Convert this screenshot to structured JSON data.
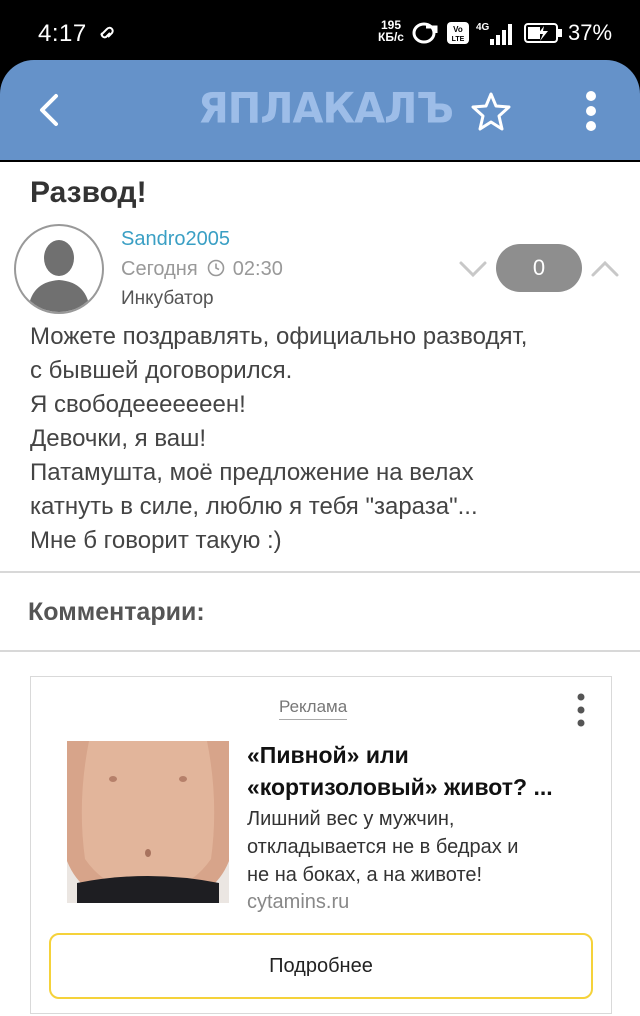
{
  "status_bar": {
    "time": "4:17",
    "speed_value": "195",
    "speed_unit": "КБ/с",
    "network_label": "4G",
    "volte_label": "Vo LTE",
    "battery_percent": "37%"
  },
  "app_bar": {
    "logo_text": "ЯПЛАКАЛЪ",
    "accent_color": "#6592c9"
  },
  "post": {
    "title": "Развод!",
    "author": "Sandro2005",
    "date": "Сегодня",
    "time": "02:30",
    "rank": "Инкубатор",
    "rating": "0",
    "body_lines": [
      "Можете поздравлять, официально разводят,",
      "с бывшей договорился.",
      "Я свободееееееен!",
      "Девочки, я ваш!",
      "Патамушта, моё предложение на велах",
      "катнуть в силе, люблю я тебя \"зараза\"...",
      "Мне б говорит такую :)"
    ]
  },
  "comments": {
    "title": "Комментарии:"
  },
  "ad": {
    "label": "Реклама",
    "headline_line1": "«Пивной» или",
    "headline_line2": "«кортизоловый» живот? ...",
    "text_line1": "Лишний вес у мужчин,",
    "text_line2": "откладывается не в бедрах и",
    "text_line3": "не на боках, а на животе!",
    "domain": "cytamins.ru",
    "button_label": "Подробнее",
    "button_border_color": "#f5d23a"
  }
}
